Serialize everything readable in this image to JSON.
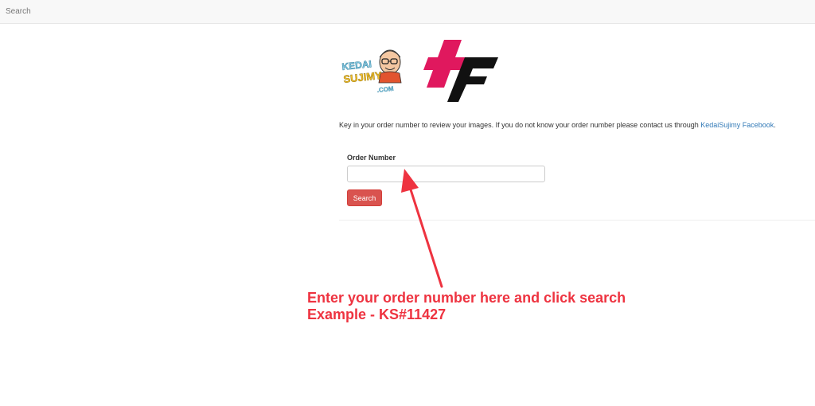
{
  "navbar": {
    "brand": "Search"
  },
  "logos": {
    "kedaisujimy_text": "KEDAI SUJIMY .COM",
    "colors": {
      "logo2_pink": "#e0185e",
      "logo2_black": "#111111"
    }
  },
  "intro": {
    "text": "Key in your order number to review your images. If you do not know your order number please contact us through ",
    "link_text": "KedaiSujimy Facebook",
    "suffix": "."
  },
  "form": {
    "label": "Order Number",
    "input_value": "",
    "input_placeholder": "",
    "button_label": "Search"
  },
  "annotation": {
    "line1": "Enter your order number here and click search",
    "line2": "Example - KS#11427",
    "color": "#ee3340"
  },
  "colors": {
    "button": "#d9534f",
    "link": "#337ab7",
    "navbar_bg": "#f8f8f8"
  }
}
